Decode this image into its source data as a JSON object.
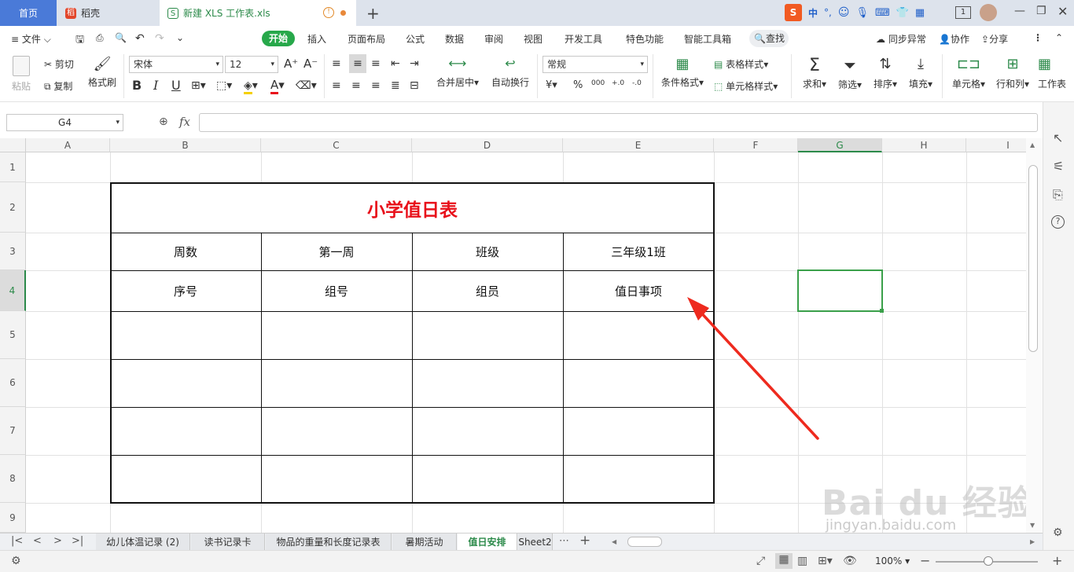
{
  "tabs": {
    "home": "首页",
    "daoke": "稻壳",
    "file": "新建 XLS 工作表.xls",
    "add": "+"
  },
  "sogou": {
    "lang": "中",
    "punct": "°,"
  },
  "window": {
    "badge": "1"
  },
  "menu": {
    "file": "文件",
    "items": [
      "开始",
      "插入",
      "页面布局",
      "公式",
      "数据",
      "审阅",
      "视图",
      "开发工具",
      "特色功能",
      "智能工具箱"
    ],
    "search": "查找",
    "sync": "同步异常",
    "collab": "协作",
    "share": "分享"
  },
  "ribbon": {
    "paste": "粘贴",
    "cut": "剪切",
    "copy": "复制",
    "format_painter": "格式刷",
    "font": "宋体",
    "size": "12",
    "grow": "A⁺",
    "shrink": "A⁻",
    "bold": "B",
    "italic": "I",
    "underline": "U",
    "merge": "合并居中",
    "wrap": "自动换行",
    "numfmt": "常规",
    "yen": "¥",
    "percent": "%",
    "thousands": "000",
    "inc_dec": "+.0",
    "dec_dec": "-.0",
    "cond_fmt": "条件格式",
    "table_style": "表格样式",
    "cell_style": "单元格样式",
    "sum": "求和",
    "filter": "筛选",
    "sort": "排序",
    "fill": "填充",
    "cell": "单元格",
    "rowcol": "行和列",
    "worksheet": "工作表"
  },
  "formula": {
    "namebox": "G4",
    "fx": "fx",
    "value": ""
  },
  "columns": [
    "A",
    "B",
    "C",
    "D",
    "E",
    "F",
    "G",
    "H",
    "I"
  ],
  "rows": [
    "1",
    "2",
    "3",
    "4",
    "5",
    "6",
    "7",
    "8",
    "9"
  ],
  "sheet_table": {
    "title": "小学值日表",
    "row3": [
      "周数",
      "第一周",
      "班级",
      "三年级1班"
    ],
    "row4": [
      "序号",
      "组号",
      "组员",
      "值日事项"
    ]
  },
  "sheets": [
    "幼儿体温记录 (2)",
    "读书记录卡",
    "物品的重量和长度记录表",
    "暑期活动",
    "值日安排",
    "Sheet2"
  ],
  "status": {
    "zoom": "100%"
  },
  "watermark": {
    "logo": "Bai du 经验",
    "url": "jingyan.baidu.com"
  },
  "colors": {
    "accent_green": "#27a84a",
    "title_red": "#e8101a",
    "arrow_red": "#ee2a1e",
    "home_tab": "#4a7ad8"
  }
}
